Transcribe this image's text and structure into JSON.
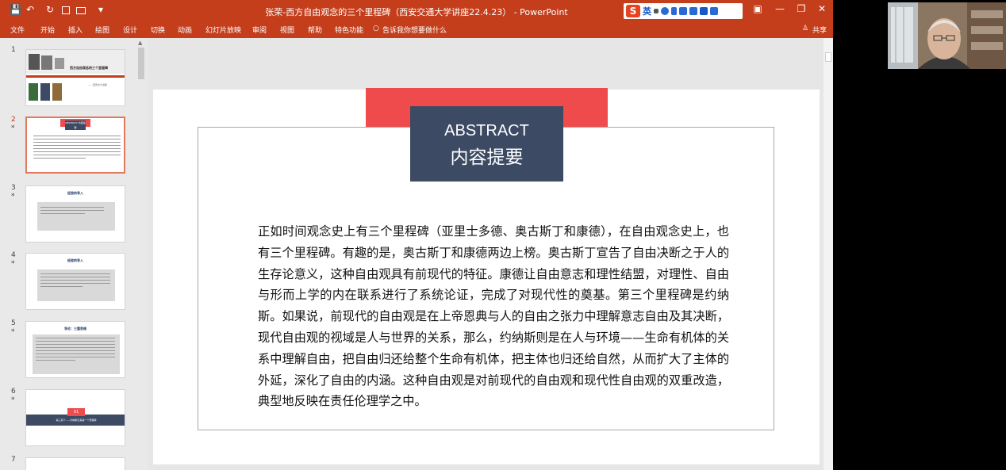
{
  "window": {
    "title": "张荣-西方自由观念的三个里程碑（西安交通大学讲座22.4.23） -  PowerPoint",
    "controls": {
      "minimize": "—",
      "restore": "❐",
      "close": "✕",
      "ribbon_display": "▣"
    },
    "quick_access": {
      "save": "💾",
      "undo": "↶",
      "redo": "↻",
      "customize": "▾"
    }
  },
  "ime_toolbar": {
    "logo": "S",
    "mode": "英"
  },
  "ribbon": {
    "tabs": [
      "文件",
      "开始",
      "插入",
      "绘图",
      "设计",
      "切换",
      "动画",
      "幻灯片放映",
      "审阅",
      "视图",
      "帮助",
      "特色功能"
    ],
    "tell_me": "告诉我你想要做什么",
    "share": "共享"
  },
  "thumbnails": [
    {
      "number": "1",
      "star": "",
      "title": "西方自由观念的三个里程碑",
      "subtitle": "——西安交大讲座"
    },
    {
      "number": "2",
      "star": "*",
      "title": "ABSTRACT 内容提要",
      "active": true
    },
    {
      "number": "3",
      "star": "*",
      "title": "经验的导入"
    },
    {
      "number": "4",
      "star": "*",
      "title": "经验的导入"
    },
    {
      "number": "5",
      "star": "*",
      "title": "导论：三重思维"
    },
    {
      "number": "6",
      "star": "*",
      "badge": "01",
      "bar_text": "第三篇下——约纳斯及其第一个里程碑"
    },
    {
      "number": "7",
      "star": ""
    }
  ],
  "slide": {
    "heading_en": "ABSTRACT",
    "heading_zh": "内容提要",
    "body": "正如时间观念史上有三个里程碑（亚里士多德、奥古斯丁和康德），在自由观念史上，也有三个里程碑。有趣的是，奥古斯丁和康德两边上榜。奥古斯丁宣告了自由决断之于人的生存论意义，这种自由观具有前现代的特征。康德让自由意志和理性结盟，对理性、自由与形而上学的内在联系进行了系统论证，完成了对现代性的奠基。第三个里程碑是约纳斯。如果说，前现代的自由观是在上帝恩典与人的自由之张力中理解意志自由及其决断，现代自由观的视域是人与世界的关系，那么，约纳斯则是在人与环境——生命有机体的关系中理解自由，把自由归还给整个生命有机体，把主体也归还给自然，从而扩大了主体的外延，深化了自由的内涵。这种自由观是对前现代的自由观和现代性自由观的双重改造，典型地反映在责任伦理学之中。"
  },
  "colors": {
    "accent": "#c43e1c",
    "slide_red": "#f04b4c",
    "slide_navy": "#3c4a64"
  }
}
